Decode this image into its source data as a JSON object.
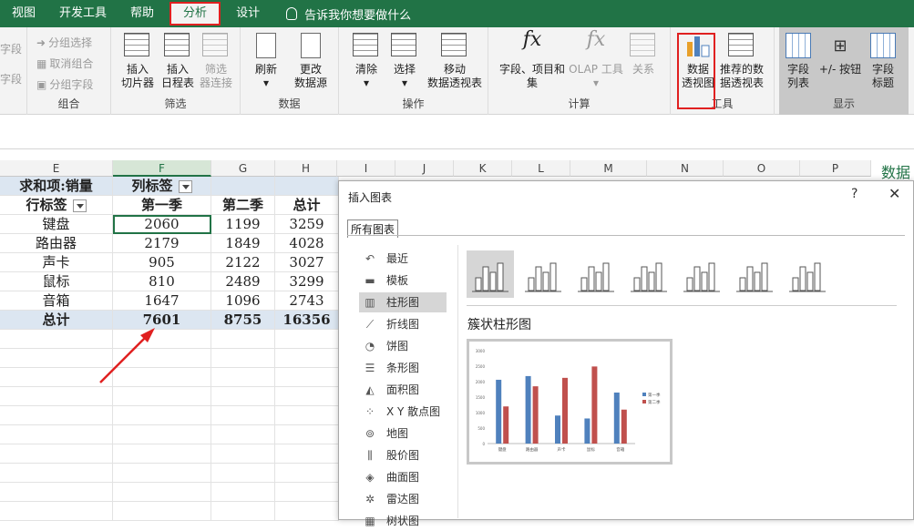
{
  "ribbon_tabs": [
    "视图",
    "开发工具",
    "帮助",
    "分析",
    "设计"
  ],
  "tell_me": "告诉我你想要做什么",
  "left_cut": [
    "字段",
    "字段"
  ],
  "groups": {
    "group": {
      "items": [
        "分组选择",
        "取消组合",
        "分组字段"
      ],
      "label": "组合"
    },
    "filter": {
      "buttons": [
        [
          "插入",
          "切片器"
        ],
        [
          "插入",
          "日程表"
        ],
        [
          "筛选",
          "器连接"
        ]
      ],
      "label": "筛选"
    },
    "data": {
      "buttons": [
        [
          "刷新",
          ""
        ],
        [
          "更改",
          "数据源"
        ]
      ],
      "label": "数据"
    },
    "actions": {
      "buttons": [
        [
          "清除",
          ""
        ],
        [
          "选择",
          ""
        ],
        [
          "移动",
          "数据透视表"
        ]
      ],
      "label": "操作"
    },
    "calc": {
      "buttons": [
        [
          "字段、项目和",
          "集"
        ],
        [
          "OLAP 工具",
          ""
        ],
        [
          "关系",
          ""
        ]
      ],
      "label": "计算"
    },
    "tools": {
      "buttons": [
        [
          "数据",
          "透视图"
        ],
        [
          "推荐的数",
          "据透视表"
        ]
      ],
      "label": "工具"
    },
    "show": {
      "buttons": [
        [
          "字段",
          "列表"
        ],
        [
          "+/- 按钮",
          ""
        ],
        [
          "字段",
          "标题"
        ]
      ],
      "label": "显示"
    }
  },
  "columns": [
    "E",
    "F",
    "G",
    "H",
    "I",
    "J",
    "K",
    "L",
    "M",
    "N",
    "O",
    "P"
  ],
  "pivot": {
    "value_label": "求和项:销量",
    "col_label": "列标签",
    "row_label": "行标签",
    "headers": [
      "第一季",
      "第二季",
      "总计"
    ],
    "rows": [
      {
        "name": "键盘",
        "v": [
          "2060",
          "1199",
          "3259"
        ]
      },
      {
        "name": "路由器",
        "v": [
          "2179",
          "1849",
          "4028"
        ]
      },
      {
        "name": "声卡",
        "v": [
          "905",
          "2122",
          "3027"
        ]
      },
      {
        "name": "鼠标",
        "v": [
          "810",
          "2489",
          "3299"
        ]
      },
      {
        "name": "音箱",
        "v": [
          "1647",
          "1096",
          "2743"
        ]
      }
    ],
    "total": {
      "name": "总计",
      "v": [
        "7601",
        "8755",
        "16356"
      ]
    }
  },
  "right_cut": "数据",
  "dialog": {
    "title": "插入图表",
    "help": "?",
    "close": "✕",
    "tab": "所有图表",
    "categories": [
      "最近",
      "模板",
      "柱形图",
      "折线图",
      "饼图",
      "条形图",
      "面积图",
      "X Y 散点图",
      "地图",
      "股价图",
      "曲面图",
      "雷达图",
      "树状图"
    ],
    "selected_category": "柱形图",
    "chart_name": "簇状柱形图"
  },
  "colors": {
    "excel_green": "#217346",
    "highlight_red": "#e02020",
    "series1": "#4f81bd",
    "series2": "#c0504d"
  },
  "chart_data": {
    "type": "bar",
    "categories": [
      "键盘",
      "路由器",
      "声卡",
      "鼠标",
      "音箱"
    ],
    "series": [
      {
        "name": "第一季",
        "values": [
          2060,
          2179,
          905,
          810,
          1647
        ]
      },
      {
        "name": "第二季",
        "values": [
          1199,
          1849,
          2122,
          2489,
          1096
        ]
      }
    ],
    "yticks": [
      "0",
      "500",
      "1000",
      "1500",
      "2000",
      "2500",
      "3000"
    ],
    "ylim": [
      0,
      3000
    ],
    "legend": "right"
  }
}
